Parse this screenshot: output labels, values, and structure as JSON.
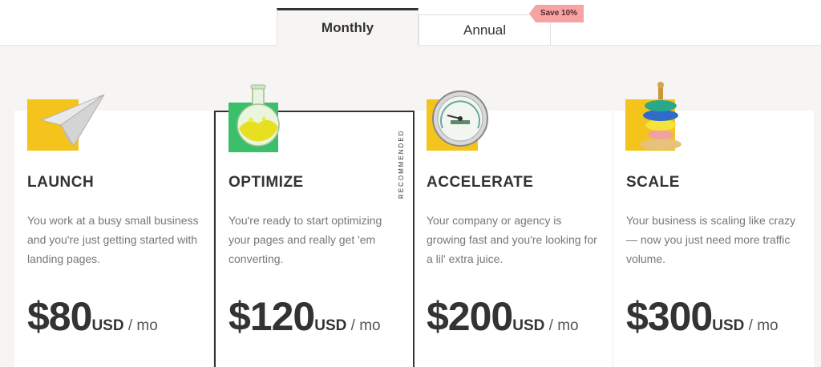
{
  "tabs": {
    "monthly": "Monthly",
    "annual": "Annual",
    "save_badge": "Save 10%"
  },
  "recommended_label": "RECOMMENDED",
  "plans": [
    {
      "title": "LAUNCH",
      "icon": "paper-plane-icon",
      "description": "You work at a busy small business and you're just getting started with landing pages.",
      "price": "$80",
      "currency": "USD",
      "period": " / mo"
    },
    {
      "title": "OPTIMIZE",
      "icon": "flask-icon",
      "description": "You're ready to start optimizing your pages and really get 'em converting.",
      "price": "$120",
      "currency": "USD",
      "period": " / mo"
    },
    {
      "title": "ACCELERATE",
      "icon": "speedometer-icon",
      "description": "Your company or agency is growing fast and you're looking for a lil' extra juice.",
      "price": "$200",
      "currency": "USD",
      "period": " / mo"
    },
    {
      "title": "SCALE",
      "icon": "stacking-rings-icon",
      "description": "Your business is scaling like crazy— now you just need more traffic volume.",
      "price": "$300",
      "currency": "USD",
      "period": " / mo"
    }
  ],
  "colors": {
    "accent_yellow": "#f4c41c",
    "accent_green": "#3bbf6a",
    "badge_pink": "#f5a3a3",
    "text_dark": "#333333",
    "text_muted": "#777777"
  }
}
